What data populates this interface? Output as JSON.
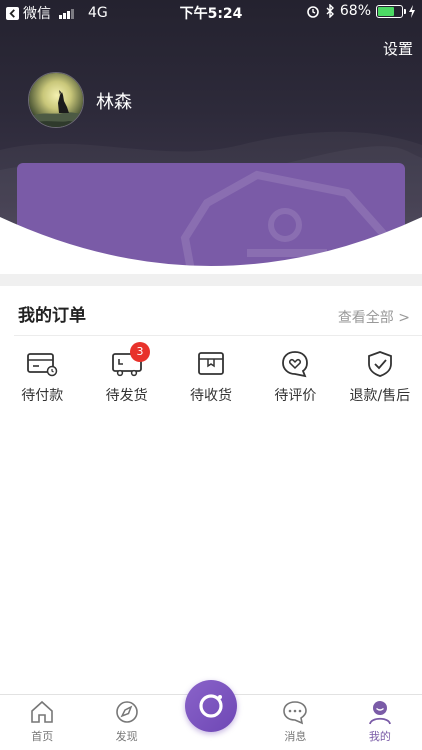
{
  "status_bar": {
    "app_back": "微信",
    "network": "4G",
    "time": "下午5:24",
    "battery_percent": "68%",
    "battery_level": 0.68
  },
  "profile": {
    "settings_label": "设置",
    "username": "林森"
  },
  "orders": {
    "title": "我的订单",
    "view_all": "查看全部 >",
    "items": [
      {
        "label": "待付款",
        "icon": "wallet-card-icon"
      },
      {
        "label": "待发货",
        "icon": "delivery-truck-icon",
        "badge": "3"
      },
      {
        "label": "待收货",
        "icon": "package-box-icon"
      },
      {
        "label": "待评价",
        "icon": "heart-chat-icon"
      },
      {
        "label": "退款/售后",
        "icon": "shield-check-icon"
      }
    ]
  },
  "tab_bar": {
    "tabs": [
      {
        "label": "首页",
        "icon": "home-icon"
      },
      {
        "label": "发现",
        "icon": "compass-icon"
      },
      {
        "label": "",
        "icon": "camera-icon"
      },
      {
        "label": "消息",
        "icon": "message-icon"
      },
      {
        "label": "我的",
        "icon": "profile-icon"
      }
    ]
  },
  "colors": {
    "accent": "#7a5ba7",
    "badge": "#e8322b",
    "header_dark": "#24222f"
  }
}
